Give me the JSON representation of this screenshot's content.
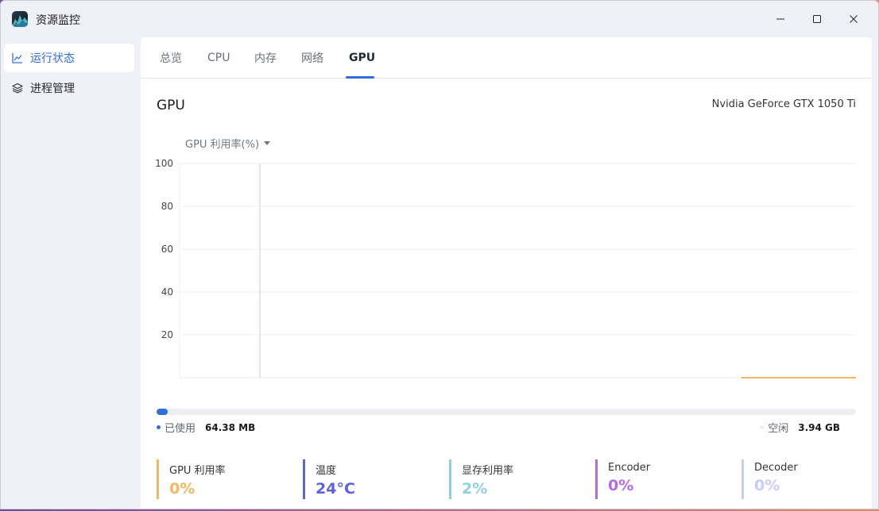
{
  "app": {
    "title": "资源监控"
  },
  "window_controls": {
    "minimize": "minimize-icon",
    "maximize": "maximize-icon",
    "close": "close-icon"
  },
  "sidebar": {
    "items": [
      {
        "label": "运行状态",
        "icon": "line-chart-icon",
        "active": true
      },
      {
        "label": "进程管理",
        "icon": "layers-icon",
        "active": false
      }
    ]
  },
  "tabs": [
    {
      "label": "总览",
      "active": false
    },
    {
      "label": "CPU",
      "active": false
    },
    {
      "label": "内存",
      "active": false
    },
    {
      "label": "网络",
      "active": false
    },
    {
      "label": "GPU",
      "active": true
    }
  ],
  "gpu": {
    "title": "GPU",
    "model": "Nvidia GeForce GTX 1050 Ti",
    "metric_select": "GPU 利用率(%)"
  },
  "chart_data": {
    "type": "line",
    "title": "",
    "xlabel": "",
    "ylabel": "GPU 利用率(%)",
    "ylim": [
      0,
      100
    ],
    "yticks": [
      100,
      80,
      60,
      40,
      20
    ],
    "grid": true,
    "series": [
      {
        "name": "",
        "color": "#f5b561",
        "x": [
          0.83,
          1.0
        ],
        "values": [
          0,
          0
        ]
      }
    ]
  },
  "memory": {
    "used_label": "已使用",
    "used_value": "64.38 MB",
    "free_label": "空闲",
    "free_value": "3.94 GB",
    "used_fraction": 0.016,
    "used_color": "#2f6fd8",
    "free_color": "#eceef2"
  },
  "stats": [
    {
      "label": "GPU 利用率",
      "value": "0%",
      "color": "#f5b561",
      "value_color": "#f5b561"
    },
    {
      "label": "温度",
      "value": "24°C",
      "color": "#5b63e0",
      "value_color": "#5b63e0"
    },
    {
      "label": "显存利用率",
      "value": "2%",
      "color": "#8fd0e0",
      "value_color": "#8fd0e0"
    },
    {
      "label": "Encoder",
      "value": "0%",
      "color": "#b36ae8",
      "value_color": "#b36ae8"
    },
    {
      "label": "Decoder",
      "value": "0%",
      "color": "#c7ccfa",
      "value_color": "#c7ccfa"
    }
  ]
}
